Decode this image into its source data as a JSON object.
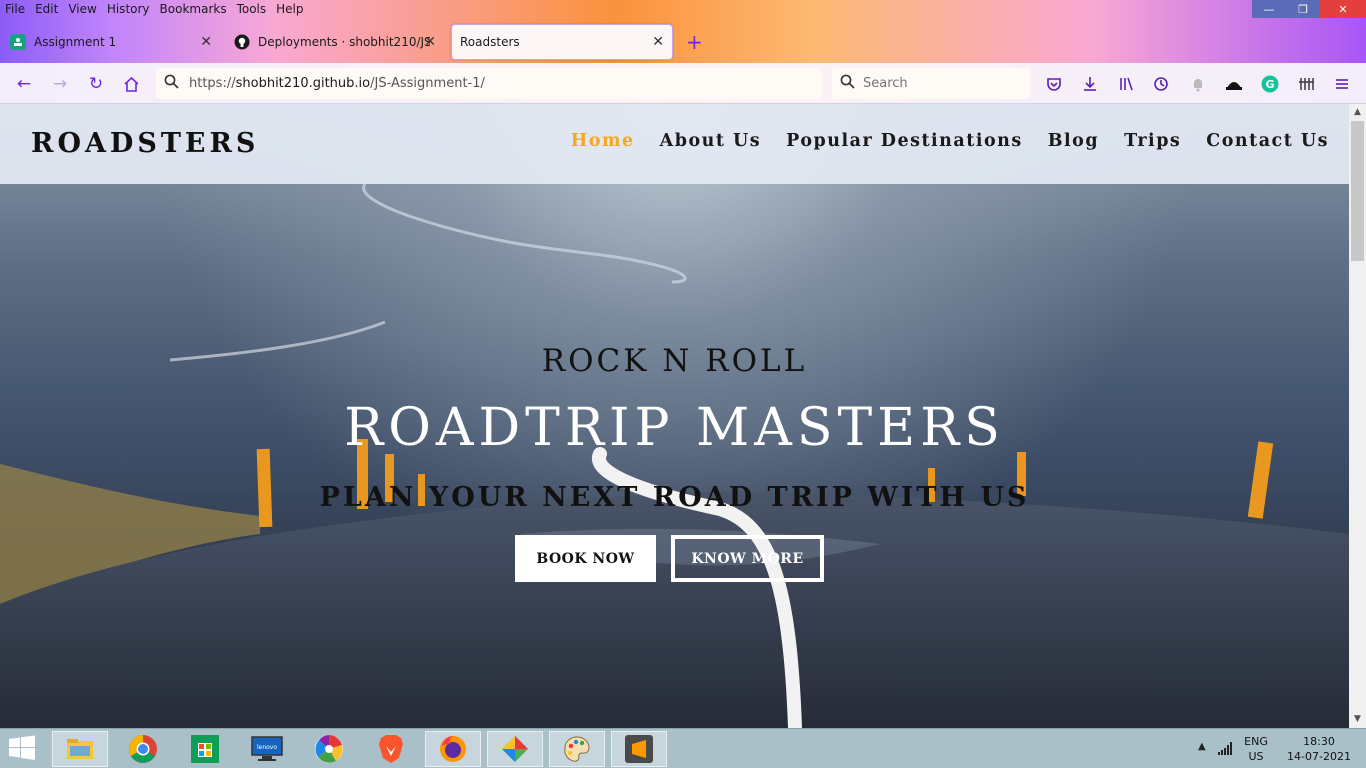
{
  "browser": {
    "menu": [
      "File",
      "Edit",
      "View",
      "History",
      "Bookmarks",
      "Tools",
      "Help"
    ],
    "tabs": [
      {
        "title": "Assignment 1",
        "icon": "classroom-icon"
      },
      {
        "title": "Deployments · shobhit210/JS-A",
        "icon": "github-icon"
      },
      {
        "title": "Roadsters",
        "icon": "none"
      }
    ],
    "url": {
      "prefix": "https://",
      "host": "shobhit210.github.io",
      "path": "/JS-Assignment-1/"
    },
    "search_placeholder": "Search"
  },
  "site": {
    "logo": "ROADSTERS",
    "nav": [
      "Home",
      "About Us",
      "Popular Destinations",
      "Blog",
      "Trips",
      "Contact Us"
    ],
    "active_nav": "Home",
    "hero": {
      "small": "ROCK N ROLL",
      "big": "ROADTRIP MASTERS",
      "sub": "PLAN YOUR NEXT ROAD TRIP WITH US",
      "btn_book": "BOOK NOW",
      "btn_know": "KNOW MORE"
    },
    "accent": "#f5a623"
  },
  "taskbar": {
    "lang_top": "ENG",
    "lang_bottom": "US",
    "time": "18:30",
    "date": "14-07-2021"
  }
}
